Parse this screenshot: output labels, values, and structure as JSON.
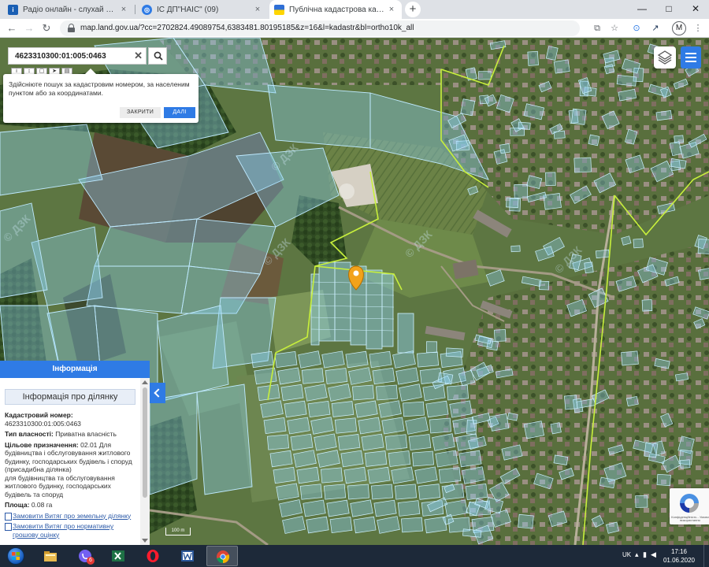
{
  "browser": {
    "tabs": [
      {
        "title": "Радіо онлайн - слухай безкошт…",
        "icon": "radio-favicon",
        "color": "#1a5fb4"
      },
      {
        "title": "ІС ДП\"НАІС\" (09)",
        "icon": "nais-favicon",
        "color": "#2f7be5"
      },
      {
        "title": "Публічна кадастрова карта Укр…",
        "icon": "ukraine-flag-favicon",
        "color": "#ffd500"
      }
    ],
    "new_tab": "+",
    "close_glyph": "×",
    "window_controls": {
      "minimize": "—",
      "maximize": "□",
      "close": "✕"
    },
    "url": "map.land.gov.ua/?cc=2702824.49089754,6383481.80195185&z=16&l=kadastr&bl=ortho10k_all",
    "profile_initial": "M"
  },
  "search": {
    "value": "4623310300:01:005:0463",
    "clear_glyph": "✕"
  },
  "tooltip": {
    "text": "Здійсніюте пошук за кадастровим номером, за населеним пунктом або за координатами.",
    "close_label": "ЗАКРИТИ",
    "next_label": "ДАЛІ"
  },
  "info_panel": {
    "header": "Інформація",
    "title": "Інформація про ділянку",
    "cadastral_label": "Кадастровий номер:",
    "cadastral_value": "4623310300:01:005:0463",
    "ownership_label": "Тип власності:",
    "ownership_value": "Приватна власність",
    "purpose_label": "Цільове призначення:",
    "purpose_value": "02.01 Для будівництва і обслуговування житлового будинку, господарських будівель і споруд (присадибна ділянка)",
    "purpose_detail": "для будівництва та обслуговування житлового будинку, господарських будівель та споруд",
    "area_label": "Площа:",
    "area_value": "0.08 га",
    "link_extract": "Замовити Витяг про земельну ділянку",
    "link_valuation": "Замовити Витяг про нормативну грошову оцінку"
  },
  "map": {
    "scale_label": "100 m",
    "watermark": "© ДЗК",
    "attribution": "Конфіденційність",
    "recaptcha_label": "Конфіденційність - Умови використання",
    "colors": {
      "parcel_fill": "#8fd3f5",
      "parcel_stroke": "#bfeaff",
      "boundary": "#c8f03c",
      "marker": "#f2a21b"
    }
  },
  "taskbar": {
    "viber_badge": "6",
    "lang": "UK",
    "time": "17:16",
    "date": "01.06.2020"
  }
}
